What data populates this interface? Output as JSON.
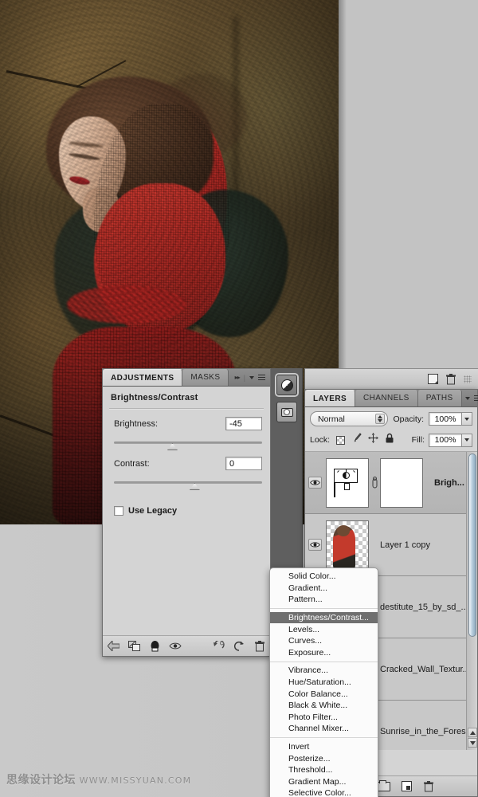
{
  "app": {
    "canvas_alt": "Photo of woman with red mesh sleeves against cracked stone wall",
    "watermark_cn": "思缘设计论坛",
    "watermark_url": "WWW.MISSYUAN.COM"
  },
  "adjustments_panel": {
    "tabs": [
      {
        "label": "ADJUSTMENTS",
        "active": true
      },
      {
        "label": "MASKS",
        "active": false
      }
    ],
    "collapse_icon": "double-arrow-right-icon",
    "menu_icon": "panel-menu-icon",
    "title": "Brightness/Contrast",
    "sliders": [
      {
        "label": "Brightness:",
        "value": "-45",
        "thumb_pct": 39
      },
      {
        "label": "Contrast:",
        "value": "0",
        "thumb_pct": 50
      }
    ],
    "use_legacy": {
      "label": "Use Legacy",
      "checked": false
    },
    "footer_icons": [
      "return-to-adjustment-list-icon",
      "clip-to-layer-icon",
      "preview-black-white-icon",
      "toggle-layer-visibility-icon",
      "reset-previous-state-icon",
      "reset-adjustment-icon",
      "delete-adjustment-layer-icon"
    ]
  },
  "icon_strip": {
    "buttons": [
      {
        "name": "adjustments-panel-icon",
        "selected": true
      },
      {
        "name": "masks-panel-icon",
        "selected": false
      }
    ]
  },
  "dock_top": {
    "icons": [
      "new-layer-icon",
      "delete-layer-icon",
      "dock-grip-icon"
    ]
  },
  "layers_panel": {
    "tabs": [
      {
        "label": "LAYERS",
        "active": true
      },
      {
        "label": "CHANNELS",
        "active": false
      },
      {
        "label": "PATHS",
        "active": false
      }
    ],
    "menu_icon": "panel-menu-icon",
    "blend_mode": "Normal",
    "opacity_label": "Opacity:",
    "opacity_value": "100%",
    "lock_label": "Lock:",
    "lock_icons": [
      "lock-transparency-icon",
      "lock-image-pixels-icon",
      "lock-position-icon",
      "lock-all-icon"
    ],
    "fill_label": "Fill:",
    "fill_value": "100%",
    "rows": [
      {
        "name": "Brigh...",
        "visible": true,
        "selected": true,
        "kind": "adjustment",
        "has_mask": true,
        "bold": true
      },
      {
        "name": "Layer 1 copy",
        "visible": true,
        "selected": false,
        "kind": "transparent-photo",
        "has_mask": false,
        "bold": false
      },
      {
        "name": "destitute_15_by_sd_...",
        "visible": true,
        "selected": false,
        "kind": "photo",
        "has_mask": false,
        "bold": false
      },
      {
        "name": "Cracked_Wall_Textur...",
        "visible": true,
        "selected": false,
        "kind": "photo",
        "has_mask": false,
        "bold": false
      },
      {
        "name": "Sunrise_in_the_Fores...",
        "visible": true,
        "selected": false,
        "kind": "photo",
        "has_mask": false,
        "bold": false
      }
    ],
    "footer_buttons": [
      {
        "name": "layer-style-button",
        "selected": false
      },
      {
        "name": "add-layer-mask-button",
        "selected": false
      },
      {
        "name": "new-adjustment-layer-button",
        "selected": true
      },
      {
        "name": "new-group-button",
        "selected": false
      },
      {
        "name": "new-layer-button",
        "selected": false
      },
      {
        "name": "delete-layer-button",
        "selected": false
      }
    ],
    "scroll_arrows": [
      "scroll-up-arrow-icon",
      "scroll-down-arrow-icon"
    ]
  },
  "context_menu": {
    "groups": [
      [
        "Solid Color...",
        "Gradient...",
        "Pattern..."
      ],
      [
        "Brightness/Contrast...",
        "Levels...",
        "Curves...",
        "Exposure..."
      ],
      [
        "Vibrance...",
        "Hue/Saturation...",
        "Color Balance...",
        "Black & White...",
        "Photo Filter...",
        "Channel Mixer..."
      ],
      [
        "Invert",
        "Posterize...",
        "Threshold...",
        "Gradient Map...",
        "Selective Color..."
      ]
    ],
    "highlighted": "Brightness/Contrast..."
  },
  "colors": {
    "panel_bg": "#d4d4d4",
    "panel_border": "#6e6e6e",
    "strip_bg": "#5f5f5f",
    "highlight": "#6f6f6f",
    "canvas_bg": "#c3c3c3",
    "accent_red": "#c2322a"
  }
}
